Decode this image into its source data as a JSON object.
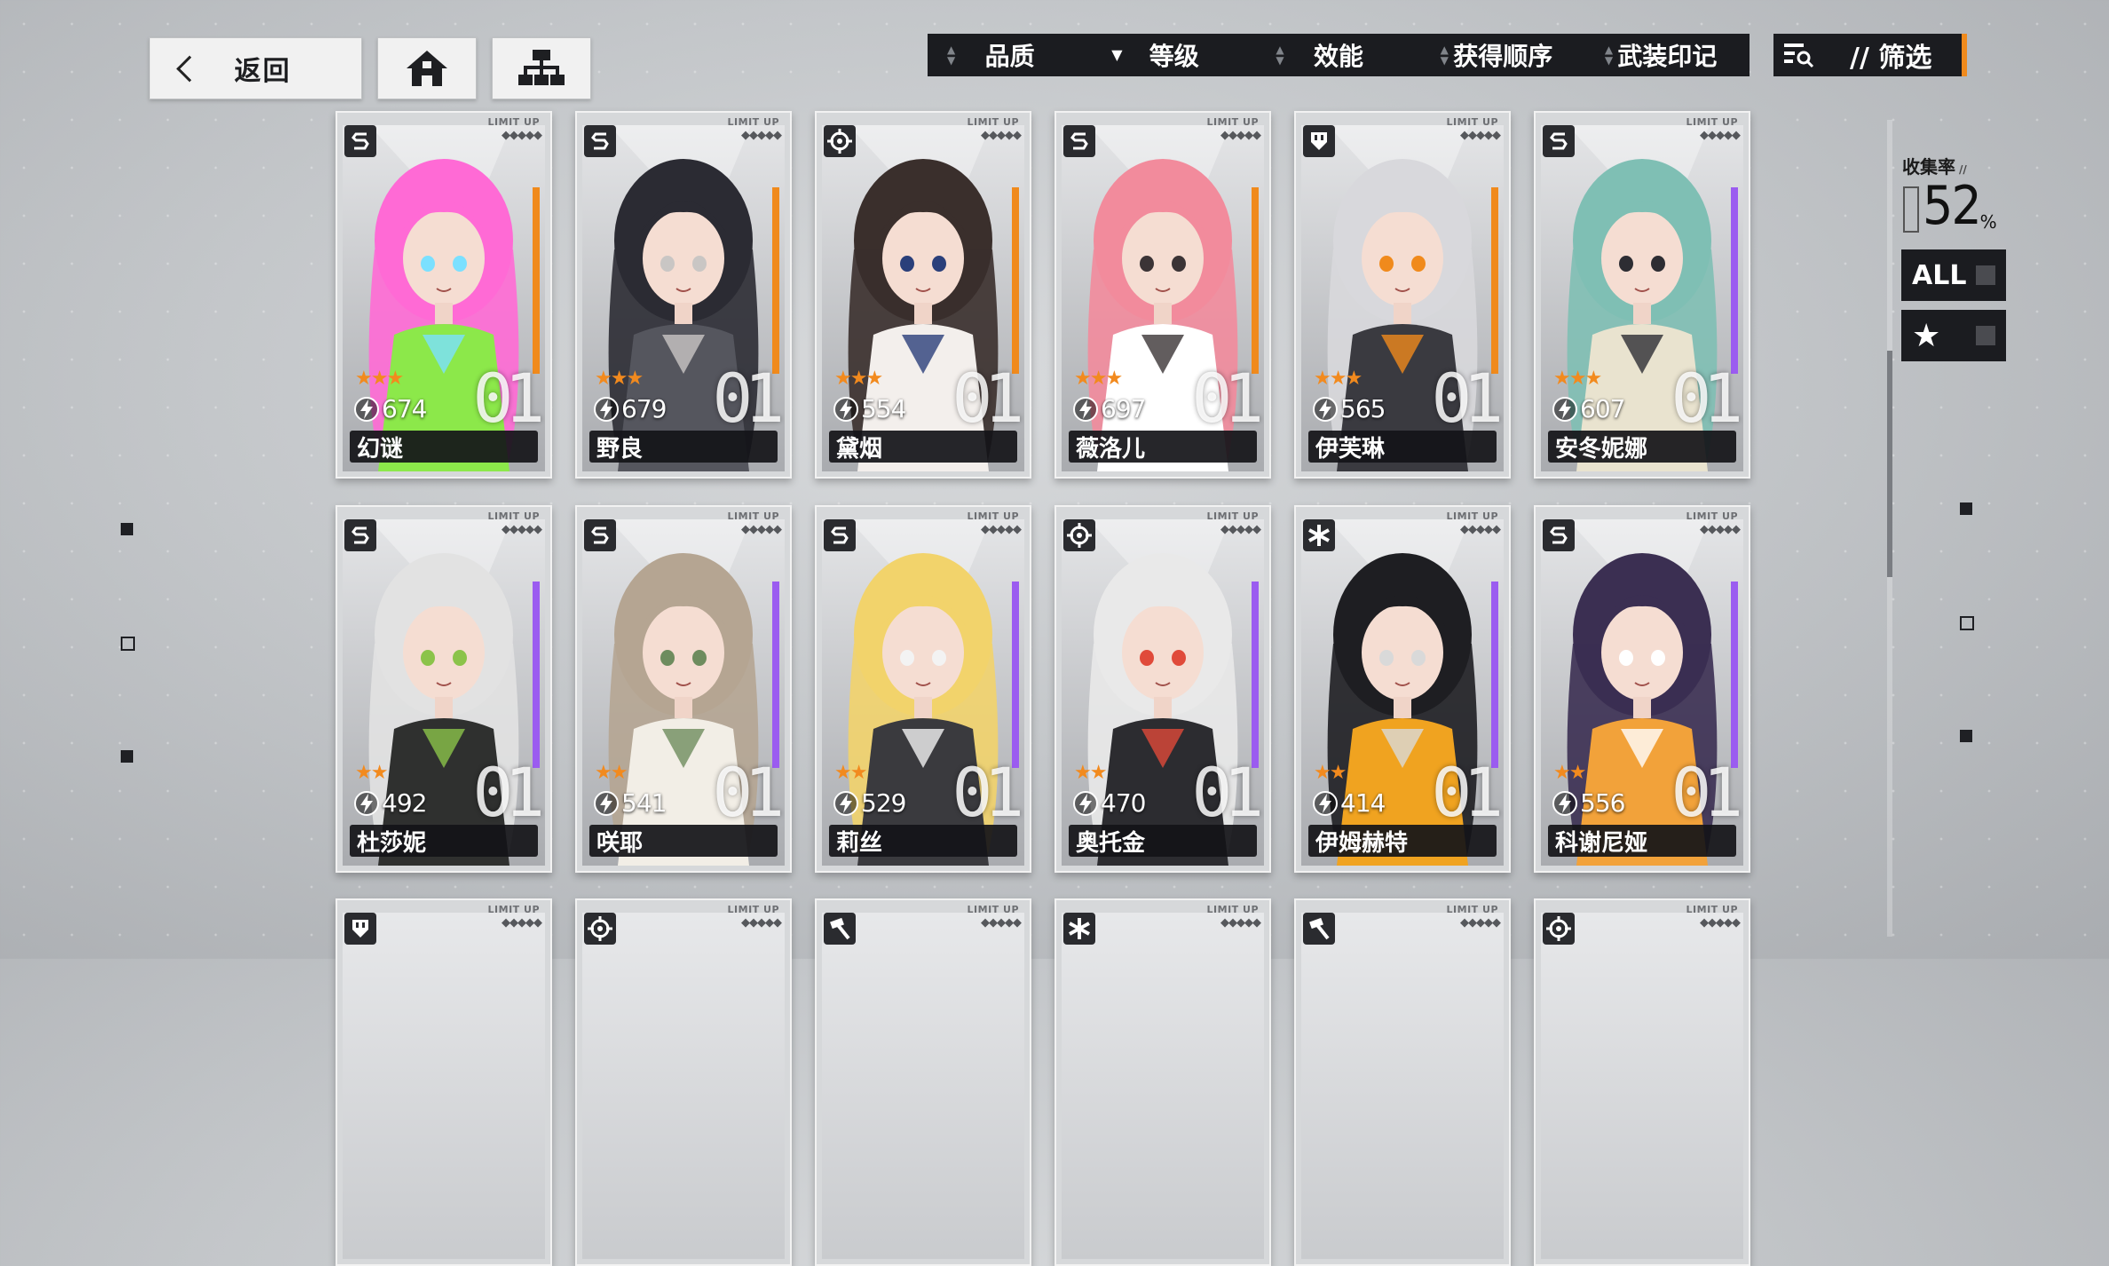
{
  "nav": {
    "back_label": "返回"
  },
  "sort": {
    "items": [
      {
        "label": "品质",
        "arrow": "▲\n▼"
      },
      {
        "label": "等级",
        "arrow": "▼"
      },
      {
        "label": "效能",
        "arrow": "▲\n▼"
      },
      {
        "label": "获得顺序",
        "arrow": "▲\n▼"
      },
      {
        "label": "武装印记",
        "arrow": "▲\n▼"
      }
    ],
    "filter_label": "// 筛选"
  },
  "side": {
    "collect_label": "收集率",
    "collect_slash": "//",
    "collect_value": "52",
    "collect_unit": "%",
    "all_label": "ALL",
    "star_label": "★"
  },
  "card_common": {
    "limit_text": "LIMIT UP",
    "diamonds": "◆◆◆◆◆",
    "number": "01"
  },
  "cards": [
    {
      "name": "幻谜",
      "power": "674",
      "stars": "★★★",
      "class_icon": "s-icon",
      "accent": "#f08a1c",
      "palette": [
        "#ff6ad5",
        "#8ce84a",
        "#7be0ff"
      ]
    },
    {
      "name": "野良",
      "power": "679",
      "stars": "★★★",
      "class_icon": "s-icon",
      "accent": "#f08a1c",
      "palette": [
        "#2b2b33",
        "#55565e",
        "#c9c6c4"
      ]
    },
    {
      "name": "黛烟",
      "power": "554",
      "stars": "★★★",
      "class_icon": "target-icon",
      "accent": "#f08a1c",
      "palette": [
        "#3a2f2c",
        "#f3efec",
        "#2a3f7a"
      ]
    },
    {
      "name": "薇洛儿",
      "power": "697",
      "stars": "★★★",
      "class_icon": "s-icon",
      "accent": "#f08a1c",
      "palette": [
        "#f28b9c",
        "#ffffff",
        "#3b3436"
      ]
    },
    {
      "name": "伊芙琳",
      "power": "565",
      "stars": "★★★",
      "class_icon": "shield-icon",
      "accent": "#f08a1c",
      "palette": [
        "#d8d8dc",
        "#3a3a40",
        "#f08a1c"
      ]
    },
    {
      "name": "安冬妮娜",
      "power": "607",
      "stars": "★★★",
      "class_icon": "s-icon",
      "accent": "#9b5cf0",
      "palette": [
        "#7fbfb4",
        "#e9e3cf",
        "#2d2d33"
      ]
    },
    {
      "name": "杜莎妮",
      "power": "492",
      "stars": "★★",
      "class_icon": "s-icon",
      "accent": "#9b5cf0",
      "palette": [
        "#e2e2e2",
        "#2f302f",
        "#8bc34a"
      ]
    },
    {
      "name": "咲耶",
      "power": "541",
      "stars": "★★",
      "class_icon": "s-icon",
      "accent": "#9b5cf0",
      "palette": [
        "#b5a592",
        "#f2eee6",
        "#6e8c5e"
      ]
    },
    {
      "name": "莉丝",
      "power": "529",
      "stars": "★★",
      "class_icon": "s-icon",
      "accent": "#9b5cf0",
      "palette": [
        "#f2d36b",
        "#3a3a3e",
        "#f3f3f3"
      ]
    },
    {
      "name": "奥托金",
      "power": "470",
      "stars": "★★",
      "class_icon": "target-icon",
      "accent": "#9b5cf0",
      "palette": [
        "#e9e9e9",
        "#2c2c30",
        "#e04a3a"
      ]
    },
    {
      "name": "伊姆赫特",
      "power": "414",
      "stars": "★★",
      "class_icon": "asterisk-icon",
      "accent": "#9b5cf0",
      "palette": [
        "#1e1e22",
        "#f0a320",
        "#d9d9d9"
      ]
    },
    {
      "name": "科谢尼娅",
      "power": "556",
      "stars": "★★",
      "class_icon": "s-icon",
      "accent": "#9b5cf0",
      "palette": [
        "#3b2f52",
        "#f2a23a",
        "#ffffff"
      ]
    }
  ],
  "partial_cards": [
    {
      "class_icon": "shield-icon"
    },
    {
      "class_icon": "target-icon"
    },
    {
      "class_icon": "hammer-icon"
    },
    {
      "class_icon": "asterisk-icon"
    },
    {
      "class_icon": "hammer-icon"
    },
    {
      "class_icon": "target-icon"
    }
  ]
}
